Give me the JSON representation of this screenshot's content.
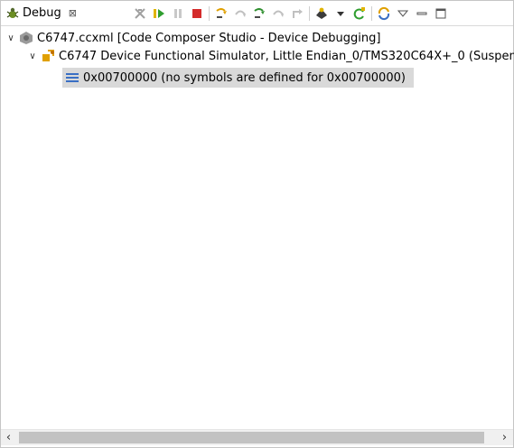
{
  "window": {
    "tab_label": "Debug",
    "close_glyph": "⊠"
  },
  "toolbar": {
    "icons": [
      "remove-all-terminated-icon",
      "resume-icon",
      "suspend-icon",
      "terminate-icon",
      "step-into-icon",
      "step-over-icon",
      "step-return-icon",
      "assembly-step-icon",
      "assembly-step-over-icon",
      "reset-cpu-icon",
      "restart-icon",
      "connect-icon",
      "view-menu-icon",
      "minimize-icon",
      "maximize-icon"
    ]
  },
  "tree": {
    "root_label": "C6747.ccxml [Code Composer Studio - Device Debugging]",
    "child_label": "C6747 Device Functional Simulator, Little Endian_0/TMS320C64X+_0 (Suspen",
    "frame_label": "0x00700000  (no symbols are defined for 0x00700000)"
  },
  "scroll": {
    "left_arrow": "‹",
    "right_arrow": "›"
  }
}
